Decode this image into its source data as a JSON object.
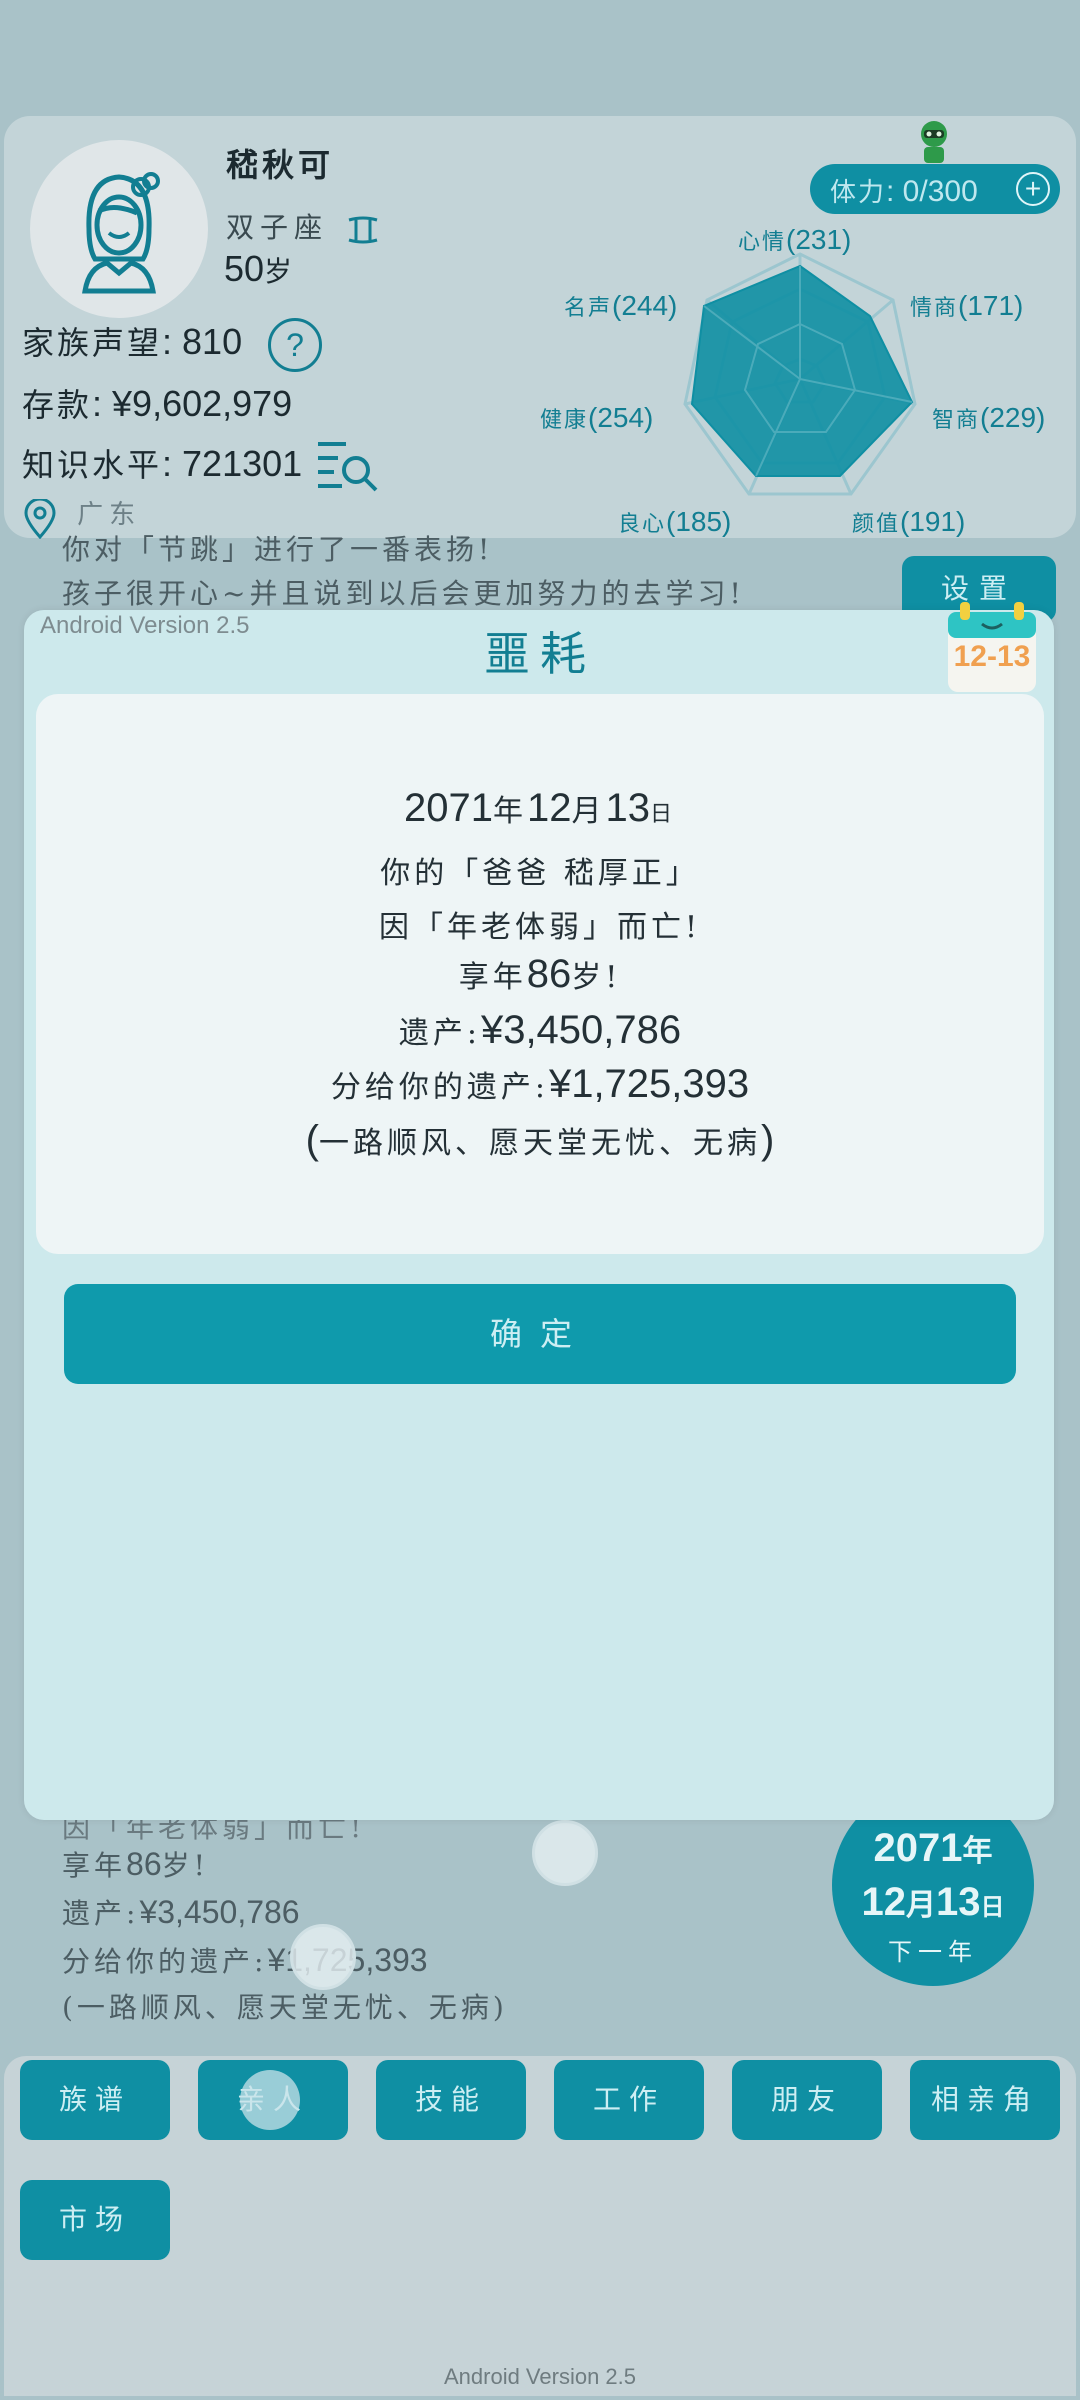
{
  "profile": {
    "name": "嵇秋可",
    "zodiac": "双子座",
    "age_value": "50",
    "age_unit": "岁",
    "reputation_label": "家族声望",
    "reputation_value": ": 810",
    "help_icon": "?",
    "savings_label": "存款",
    "savings_value": ": ¥9,602,979",
    "knowledge_label": "知识水平",
    "knowledge_value": ": 721301",
    "location": "广东"
  },
  "stamina": {
    "label": "体力",
    "value": ": 0/300",
    "plus": "+"
  },
  "radar": {
    "mood": {
      "label": "心情",
      "value": "(231)"
    },
    "eq": {
      "label": "情商",
      "value": "(171)"
    },
    "iq": {
      "label": "智商",
      "value": "(229)"
    },
    "looks": {
      "label": "颜值",
      "value": "(191)"
    },
    "conscience": {
      "label": "良心",
      "value": "(185)"
    },
    "health": {
      "label": "健康",
      "value": "(254)"
    },
    "fame": {
      "label": "名声",
      "value": "(244)"
    }
  },
  "log": {
    "line1": "你对「节跳」进行了一番表扬!",
    "line2": "孩子很开心~并且说到以后会更加努力的去学习!",
    "line3": "因「年老体弱」而亡!",
    "line4_a": "享年",
    "line4_n": "86",
    "line4_b": "岁!",
    "line5_a": "遗产:",
    "line5_n": "¥3,450,786",
    "line6_a": "分给你的遗产:",
    "line6_n": "¥1,725,393",
    "line7": "(一路顺风、愿天堂无忧、无病)"
  },
  "settings_label": "设置",
  "modal": {
    "version": "Android Version 2.5",
    "title": "噩耗",
    "calendar_date": "12-13",
    "date_year": "2071",
    "date_year_unit": "年",
    "date_month": "12",
    "date_month_unit": "月",
    "date_day": "13",
    "date_day_unit": "日",
    "line_relation": "你的「爸爸 嵇厚正」",
    "line_cause": "因「年老体弱」而亡!",
    "line_age_a": "享年",
    "line_age_n": "86",
    "line_age_b": "岁!",
    "line_estate_a": "遗产:",
    "line_estate_n": "¥3,450,786",
    "line_share_a": "分给你的遗产:",
    "line_share_n": "¥1,725,393",
    "line_blessing_a": "(",
    "line_blessing_t": "一路顺风、愿天堂无忧、无病",
    "line_blessing_b": ")",
    "confirm_label": "确定"
  },
  "year_circle": {
    "year": "2071",
    "year_unit": "年",
    "month": "12",
    "month_unit": "月",
    "day": "13",
    "day_unit": "日",
    "next_label": "下一年"
  },
  "nav": [
    "族谱",
    "亲人",
    "技能",
    "工作",
    "朋友",
    "相亲角",
    "市场"
  ],
  "footer_version": "Android Version 2.5",
  "colors": {
    "accent": "#0f8fa3",
    "background": "#a9c2c8",
    "card": "#eef5f6",
    "modal": "#cde9ec",
    "badge_orange": "#f0a050"
  }
}
